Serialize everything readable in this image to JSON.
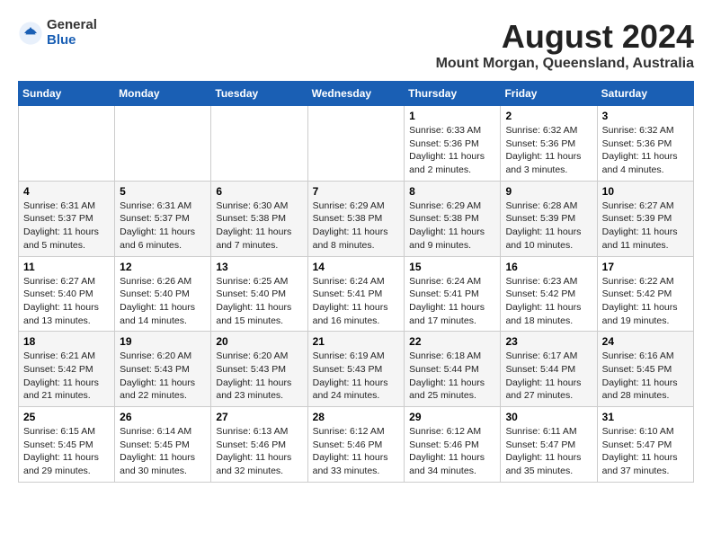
{
  "logo": {
    "general": "General",
    "blue": "Blue"
  },
  "title": {
    "month_year": "August 2024",
    "location": "Mount Morgan, Queensland, Australia"
  },
  "days_of_week": [
    "Sunday",
    "Monday",
    "Tuesday",
    "Wednesday",
    "Thursday",
    "Friday",
    "Saturday"
  ],
  "weeks": [
    [
      {
        "day": "",
        "info": ""
      },
      {
        "day": "",
        "info": ""
      },
      {
        "day": "",
        "info": ""
      },
      {
        "day": "",
        "info": ""
      },
      {
        "day": "1",
        "info": "Sunrise: 6:33 AM\nSunset: 5:36 PM\nDaylight: 11 hours and 2 minutes."
      },
      {
        "day": "2",
        "info": "Sunrise: 6:32 AM\nSunset: 5:36 PM\nDaylight: 11 hours and 3 minutes."
      },
      {
        "day": "3",
        "info": "Sunrise: 6:32 AM\nSunset: 5:36 PM\nDaylight: 11 hours and 4 minutes."
      }
    ],
    [
      {
        "day": "4",
        "info": "Sunrise: 6:31 AM\nSunset: 5:37 PM\nDaylight: 11 hours and 5 minutes."
      },
      {
        "day": "5",
        "info": "Sunrise: 6:31 AM\nSunset: 5:37 PM\nDaylight: 11 hours and 6 minutes."
      },
      {
        "day": "6",
        "info": "Sunrise: 6:30 AM\nSunset: 5:38 PM\nDaylight: 11 hours and 7 minutes."
      },
      {
        "day": "7",
        "info": "Sunrise: 6:29 AM\nSunset: 5:38 PM\nDaylight: 11 hours and 8 minutes."
      },
      {
        "day": "8",
        "info": "Sunrise: 6:29 AM\nSunset: 5:38 PM\nDaylight: 11 hours and 9 minutes."
      },
      {
        "day": "9",
        "info": "Sunrise: 6:28 AM\nSunset: 5:39 PM\nDaylight: 11 hours and 10 minutes."
      },
      {
        "day": "10",
        "info": "Sunrise: 6:27 AM\nSunset: 5:39 PM\nDaylight: 11 hours and 11 minutes."
      }
    ],
    [
      {
        "day": "11",
        "info": "Sunrise: 6:27 AM\nSunset: 5:40 PM\nDaylight: 11 hours and 13 minutes."
      },
      {
        "day": "12",
        "info": "Sunrise: 6:26 AM\nSunset: 5:40 PM\nDaylight: 11 hours and 14 minutes."
      },
      {
        "day": "13",
        "info": "Sunrise: 6:25 AM\nSunset: 5:40 PM\nDaylight: 11 hours and 15 minutes."
      },
      {
        "day": "14",
        "info": "Sunrise: 6:24 AM\nSunset: 5:41 PM\nDaylight: 11 hours and 16 minutes."
      },
      {
        "day": "15",
        "info": "Sunrise: 6:24 AM\nSunset: 5:41 PM\nDaylight: 11 hours and 17 minutes."
      },
      {
        "day": "16",
        "info": "Sunrise: 6:23 AM\nSunset: 5:42 PM\nDaylight: 11 hours and 18 minutes."
      },
      {
        "day": "17",
        "info": "Sunrise: 6:22 AM\nSunset: 5:42 PM\nDaylight: 11 hours and 19 minutes."
      }
    ],
    [
      {
        "day": "18",
        "info": "Sunrise: 6:21 AM\nSunset: 5:42 PM\nDaylight: 11 hours and 21 minutes."
      },
      {
        "day": "19",
        "info": "Sunrise: 6:20 AM\nSunset: 5:43 PM\nDaylight: 11 hours and 22 minutes."
      },
      {
        "day": "20",
        "info": "Sunrise: 6:20 AM\nSunset: 5:43 PM\nDaylight: 11 hours and 23 minutes."
      },
      {
        "day": "21",
        "info": "Sunrise: 6:19 AM\nSunset: 5:43 PM\nDaylight: 11 hours and 24 minutes."
      },
      {
        "day": "22",
        "info": "Sunrise: 6:18 AM\nSunset: 5:44 PM\nDaylight: 11 hours and 25 minutes."
      },
      {
        "day": "23",
        "info": "Sunrise: 6:17 AM\nSunset: 5:44 PM\nDaylight: 11 hours and 27 minutes."
      },
      {
        "day": "24",
        "info": "Sunrise: 6:16 AM\nSunset: 5:45 PM\nDaylight: 11 hours and 28 minutes."
      }
    ],
    [
      {
        "day": "25",
        "info": "Sunrise: 6:15 AM\nSunset: 5:45 PM\nDaylight: 11 hours and 29 minutes."
      },
      {
        "day": "26",
        "info": "Sunrise: 6:14 AM\nSunset: 5:45 PM\nDaylight: 11 hours and 30 minutes."
      },
      {
        "day": "27",
        "info": "Sunrise: 6:13 AM\nSunset: 5:46 PM\nDaylight: 11 hours and 32 minutes."
      },
      {
        "day": "28",
        "info": "Sunrise: 6:12 AM\nSunset: 5:46 PM\nDaylight: 11 hours and 33 minutes."
      },
      {
        "day": "29",
        "info": "Sunrise: 6:12 AM\nSunset: 5:46 PM\nDaylight: 11 hours and 34 minutes."
      },
      {
        "day": "30",
        "info": "Sunrise: 6:11 AM\nSunset: 5:47 PM\nDaylight: 11 hours and 35 minutes."
      },
      {
        "day": "31",
        "info": "Sunrise: 6:10 AM\nSunset: 5:47 PM\nDaylight: 11 hours and 37 minutes."
      }
    ]
  ]
}
